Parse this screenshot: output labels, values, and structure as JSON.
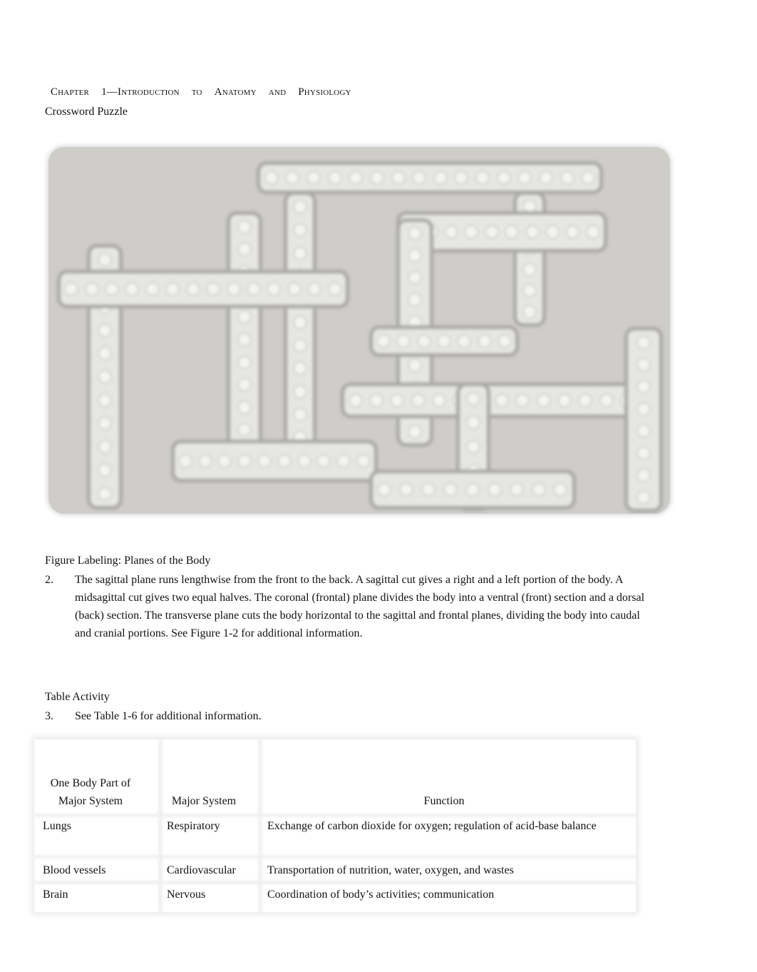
{
  "header": {
    "chapter_words": [
      "Chapter",
      "1—Introduction",
      "to",
      "Anatomy",
      "and",
      "Physiology"
    ]
  },
  "crossword": {
    "title": "Crossword Puzzle",
    "note": "Letters are blurred and not legible",
    "background_color": "#cfcdc9",
    "strip_color": "#a9a8a5"
  },
  "figure_labeling": {
    "title": "Figure Labeling: Planes of the Body",
    "number": "2.",
    "text": "The sagittal plane runs lengthwise from the front to the back. A sagittal cut gives a right and a left portion of the body. A midsagittal cut gives two equal halves. The coronal (frontal) plane divides the body into a ventral (front) section and a dorsal (back) section. The transverse plane cuts the body horizontal to the sagittal and frontal planes, dividing the body into caudal and cranial portions. See Figure 1-2 for additional information."
  },
  "table_activity": {
    "title": "Table Activity",
    "number": "3.",
    "text": "See Table 1-6 for additional information.",
    "columns": [
      "One Body Part of Major System",
      "Major System",
      "Function"
    ],
    "rows": [
      {
        "part": "Lungs",
        "system": "Respiratory",
        "function": "Exchange of carbon dioxide for oxygen; regulation of acid-base balance"
      },
      {
        "part": "Blood vessels",
        "system": "Cardiovascular",
        "function": "Transportation of nutrition, water, oxygen, and wastes"
      },
      {
        "part": "Brain",
        "system": "Nervous",
        "function": "Coordination of body’s activities; communication"
      }
    ]
  }
}
